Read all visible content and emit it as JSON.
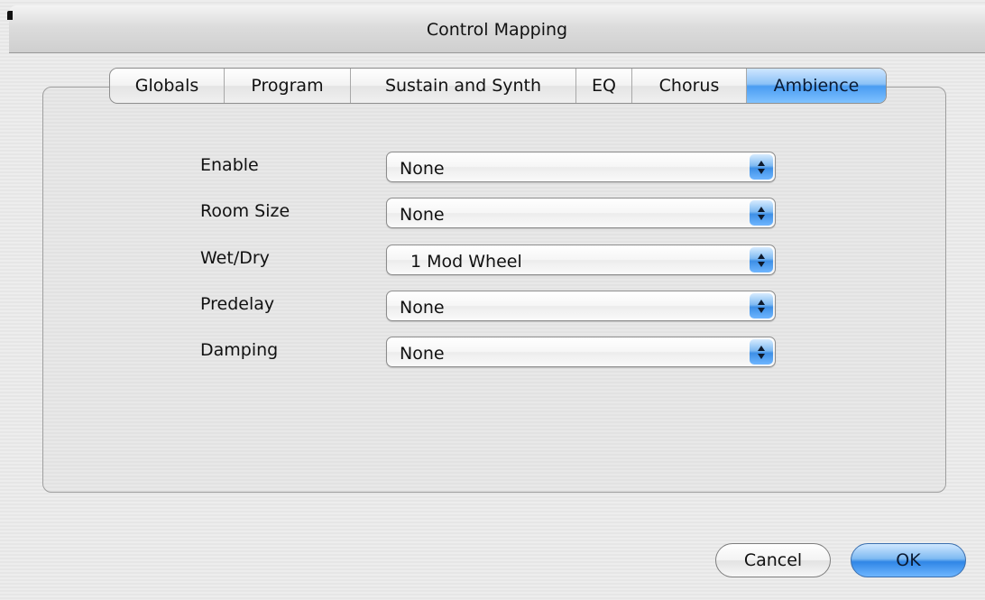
{
  "window": {
    "title": "Control Mapping"
  },
  "tabs": [
    {
      "label": "Globals",
      "selected": false
    },
    {
      "label": "Program",
      "selected": false
    },
    {
      "label": "Sustain and Synth",
      "selected": false
    },
    {
      "label": "EQ",
      "selected": false
    },
    {
      "label": "Chorus",
      "selected": false
    },
    {
      "label": "Ambience",
      "selected": true
    }
  ],
  "fields": [
    {
      "label": "Enable",
      "value": "None"
    },
    {
      "label": "Room Size",
      "value": "None"
    },
    {
      "label": "Wet/Dry",
      "value": "1 Mod Wheel"
    },
    {
      "label": "Predelay",
      "value": "None"
    },
    {
      "label": "Damping",
      "value": "None"
    }
  ],
  "buttons": {
    "cancel": "Cancel",
    "ok": "OK"
  },
  "colors": {
    "accent_blue": "#4a9cf2",
    "window_bg": "#ececec"
  }
}
